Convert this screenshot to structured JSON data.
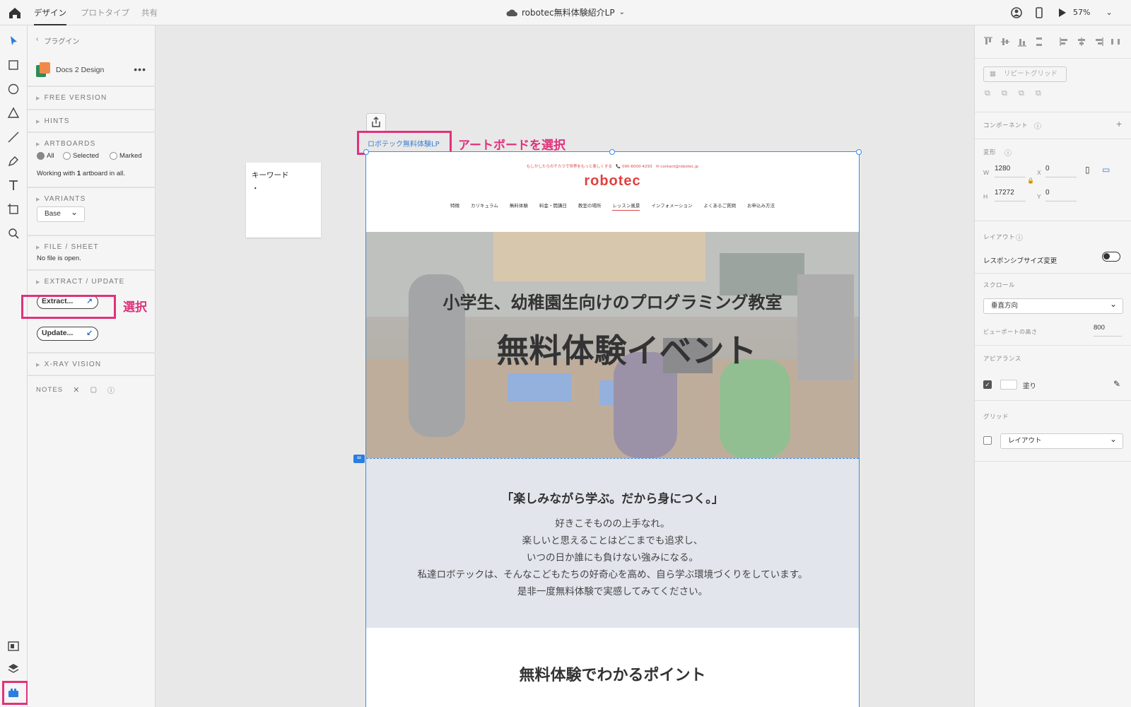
{
  "topbar": {
    "tabs": [
      "デザイン",
      "プロトタイプ",
      "共有"
    ],
    "doc_title": "robotec無料体験紹介LP",
    "zoom": "57%"
  },
  "plugin_panel": {
    "back_label": "プラグイン",
    "plugin_name": "Docs 2 Design",
    "sections": {
      "free_version": "FREE VERSION",
      "hints": "HINTS",
      "artboards": "ARTBOARDS",
      "variants": "VARIANTS",
      "file_sheet": "FILE / SHEET",
      "extract_update": "EXTRACT / UPDATE",
      "xray": "X-RAY VISION",
      "notes": "NOTES"
    },
    "radio_all": "All",
    "radio_selected": "Selected",
    "radio_marked": "Marked",
    "working_prefix": "Working with ",
    "working_count": "1",
    "working_suffix": " artboard in all.",
    "variant_value": "Base",
    "file_status": "No file is open.",
    "extract_label": "Extract...",
    "update_label": "Update..."
  },
  "annotations": {
    "select_artboard": "アートボードを選択",
    "select": "選択"
  },
  "canvas": {
    "sticky_title": "キーワード",
    "sticky_bullet": "・",
    "artboard_label": "ロボテック無料体験LP",
    "site": {
      "info_line": "もしかしたらのチカラで世界をもっと楽しくする　📞 090-6000-4293　✉ contact@robotec.jp",
      "logo": "robotec",
      "nav": [
        "特徴",
        "カリキュラム",
        "無料体験",
        "料金・開講日",
        "教室の場所",
        "レッスン風景",
        "インフォメーション",
        "よくあるご質問",
        "お申込み方法"
      ],
      "hero_sub": "小学生、幼稚園生向けのプログラミング教室",
      "hero_main": "無料体験イベント",
      "s2_title": "「楽しみながら学ぶ。だから身につく。」",
      "s2_lines": [
        "好きこそものの上手なれ。",
        "楽しいと思えることはどこまでも追求し、",
        "いつの日か誰にも負けない強みになる。",
        "私達ロボテックは、そんなこどもたちの好奇心を高め、自ら学ぶ環境づくりをしています。",
        "是非一度無料体験で実感してみてください。"
      ],
      "s3_title": "無料体験でわかるポイント"
    }
  },
  "right_panel": {
    "repeat_grid": "リピートグリッド",
    "component": "コンポーネント",
    "transform": "変形",
    "w_label": "W",
    "w": "1280",
    "x_label": "X",
    "x": "0",
    "h_label": "H",
    "h": "17272",
    "y_label": "Y",
    "y": "0",
    "layout": "レイアウト",
    "responsive": "レスポンシブサイズ変更",
    "scroll": "スクロール",
    "scroll_value": "垂直方向",
    "viewport": "ビューポートの高さ",
    "viewport_value": "800",
    "appearance": "アピアランス",
    "fill": "塗り",
    "grid": "グリッド",
    "grid_value": "レイアウト"
  },
  "colors": {
    "accent_pink": "#e0327c",
    "selection_blue": "#3a8ee6"
  }
}
